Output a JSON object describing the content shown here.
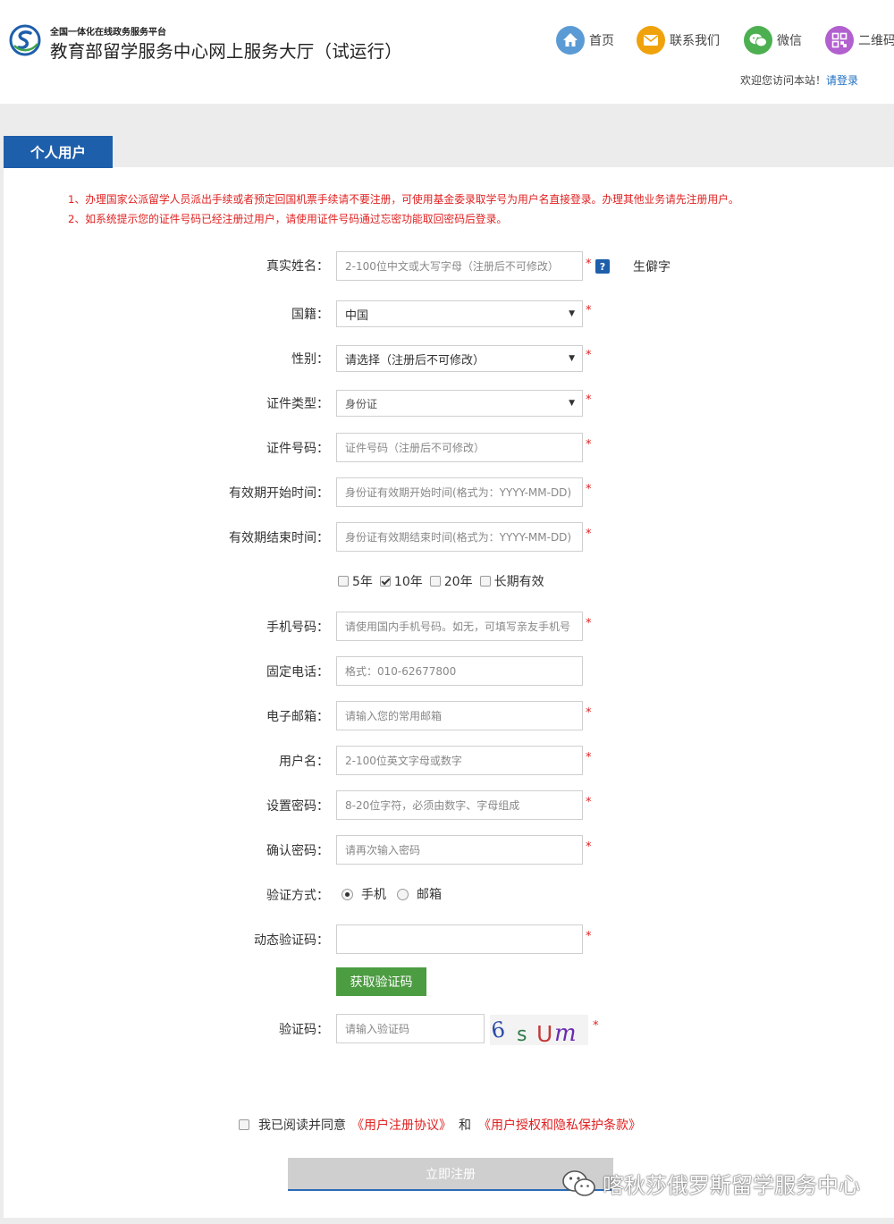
{
  "header": {
    "platform": "全国一体化在线政务服务平台",
    "title": "教育部留学服务中心网上服务大厅（试运行）",
    "nav": [
      {
        "label": "首页",
        "icon": "home-icon",
        "color": "#5b9bd5"
      },
      {
        "label": "联系我们",
        "icon": "mail-icon",
        "color": "#f0a20c"
      },
      {
        "label": "微信",
        "icon": "wechat-icon",
        "color": "#4caf50"
      },
      {
        "label": "二维码",
        "icon": "qrcode-icon",
        "color": "#b25fcf"
      }
    ],
    "welcome": "欢迎您访问本站！",
    "login_link": "请登录"
  },
  "tab": {
    "label": "个人用户"
  },
  "notices": [
    "1、办理国家公派留学人员派出手续或者预定回国机票手续请不要注册，可使用基金委录取学号为用户名直接登录。办理其他业务请先注册用户。",
    "2、如系统提示您的证件号码已经注册过用户，请使用证件号码通过忘密功能取回密码后登录。"
  ],
  "form": {
    "name": {
      "label": "真实姓名：",
      "placeholder": "2-100位中文或大写字母（注册后不可修改）",
      "rare_char": "生僻字"
    },
    "nationality": {
      "label": "国籍：",
      "value": "中国"
    },
    "gender": {
      "label": "性别：",
      "value": "请选择（注册后不可修改）"
    },
    "id_type": {
      "label": "证件类型：",
      "value": "身份证"
    },
    "id_number": {
      "label": "证件号码：",
      "placeholder": "证件号码（注册后不可修改）"
    },
    "valid_start": {
      "label": "有效期开始时间：",
      "placeholder": "身份证有效期开始时间(格式为：YYYY-MM-DD)"
    },
    "valid_end": {
      "label": "有效期结束时间：",
      "placeholder": "身份证有效期结束时间(格式为：YYYY-MM-DD)"
    },
    "periods": [
      {
        "label": "5年",
        "checked": false
      },
      {
        "label": "10年",
        "checked": true
      },
      {
        "label": "20年",
        "checked": false
      },
      {
        "label": "长期有效",
        "checked": false
      }
    ],
    "mobile": {
      "label": "手机号码：",
      "placeholder": "请使用国内手机号码。如无，可填写亲友手机号"
    },
    "phone": {
      "label": "固定电话：",
      "placeholder": "格式：010-62677800"
    },
    "email": {
      "label": "电子邮箱：",
      "placeholder": "请输入您的常用邮箱"
    },
    "username": {
      "label": "用户名：",
      "placeholder": "2-100位英文字母或数字"
    },
    "password": {
      "label": "设置密码：",
      "placeholder": "8-20位字符，必须由数字、字母组成"
    },
    "confirm": {
      "label": "确认密码：",
      "placeholder": "请再次输入密码"
    },
    "verify_method": {
      "label": "验证方式：",
      "options": [
        "手机",
        "邮箱"
      ],
      "selected": "手机"
    },
    "dynamic_code": {
      "label": "动态验证码：",
      "placeholder": ""
    },
    "get_code_button": "获取验证码",
    "captcha": {
      "label": "验证码：",
      "placeholder": "请输入验证码",
      "text": "6sUm"
    },
    "required_mark": "*",
    "help_mark": "?"
  },
  "agreement": {
    "prefix": "我已阅读并同意",
    "terms": "《用户注册协议》",
    "and": "和",
    "privacy": "《用户授权和隐私保护条款》"
  },
  "submit_label": "立即注册",
  "watermark": "喀秋莎俄罗斯留学服务中心"
}
